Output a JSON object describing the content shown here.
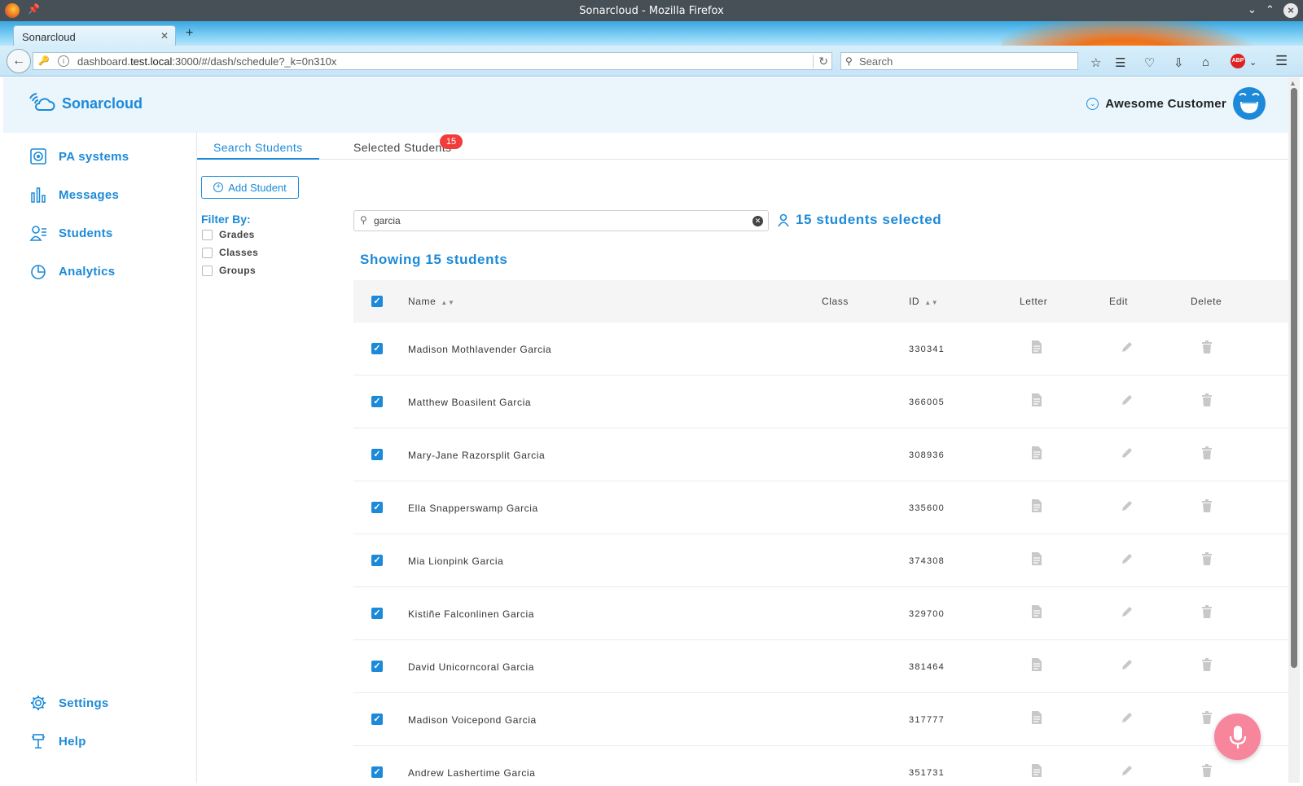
{
  "window": {
    "title": "Sonarcloud - Mozilla Firefox",
    "tab_title": "Sonarcloud",
    "url_prefix": "dashboard.",
    "url_host": "test.local",
    "url_rest": ":3000/#/dash/schedule?_k=0n310x",
    "search_placeholder": "Search"
  },
  "app": {
    "brand": "Sonarcloud",
    "user_name": "Awesome Customer",
    "accent_color": "#1c8ad8"
  },
  "sidebar": {
    "items": [
      {
        "label": "PA systems",
        "icon": "pa-systems-icon"
      },
      {
        "label": "Messages",
        "icon": "bar-chart-icon"
      },
      {
        "label": "Students",
        "icon": "students-icon"
      },
      {
        "label": "Analytics",
        "icon": "pie-chart-icon"
      }
    ],
    "bottom": [
      {
        "label": "Settings",
        "icon": "gear-icon"
      },
      {
        "label": "Help",
        "icon": "help-icon"
      }
    ]
  },
  "tabs": {
    "search": "Search Students",
    "selected": "Selected Students",
    "selected_badge": "15"
  },
  "toolbar": {
    "add_student": "Add Student"
  },
  "filter": {
    "title": "Filter By:",
    "options": [
      "Grades",
      "Classes",
      "Groups"
    ]
  },
  "search": {
    "value": "garcia"
  },
  "selection": {
    "text": "15 students selected"
  },
  "results": {
    "showing": "Showing 15 students"
  },
  "table": {
    "headers": {
      "name": "Name",
      "class": "Class",
      "id": "ID",
      "letter": "Letter",
      "edit": "Edit",
      "delete": "Delete"
    },
    "rows": [
      {
        "name": "Madison Mothlavender Garcia",
        "class": "",
        "id": "330341"
      },
      {
        "name": "Matthew Boasilent Garcia",
        "class": "",
        "id": "366005"
      },
      {
        "name": "Mary-Jane Razorsplit Garcia",
        "class": "",
        "id": "308936"
      },
      {
        "name": "Ella Snapperswamp Garcia",
        "class": "",
        "id": "335600"
      },
      {
        "name": "Mia Lionpink Garcia",
        "class": "",
        "id": "374308"
      },
      {
        "name": "Kistiñe Falconlinen Garcia",
        "class": "",
        "id": "329700"
      },
      {
        "name": "David Unicorncoral Garcia",
        "class": "",
        "id": "381464"
      },
      {
        "name": "Madison Voicepond Garcia",
        "class": "",
        "id": "317777"
      },
      {
        "name": "Andrew Lashertime Garcia",
        "class": "",
        "id": "351731"
      }
    ]
  }
}
